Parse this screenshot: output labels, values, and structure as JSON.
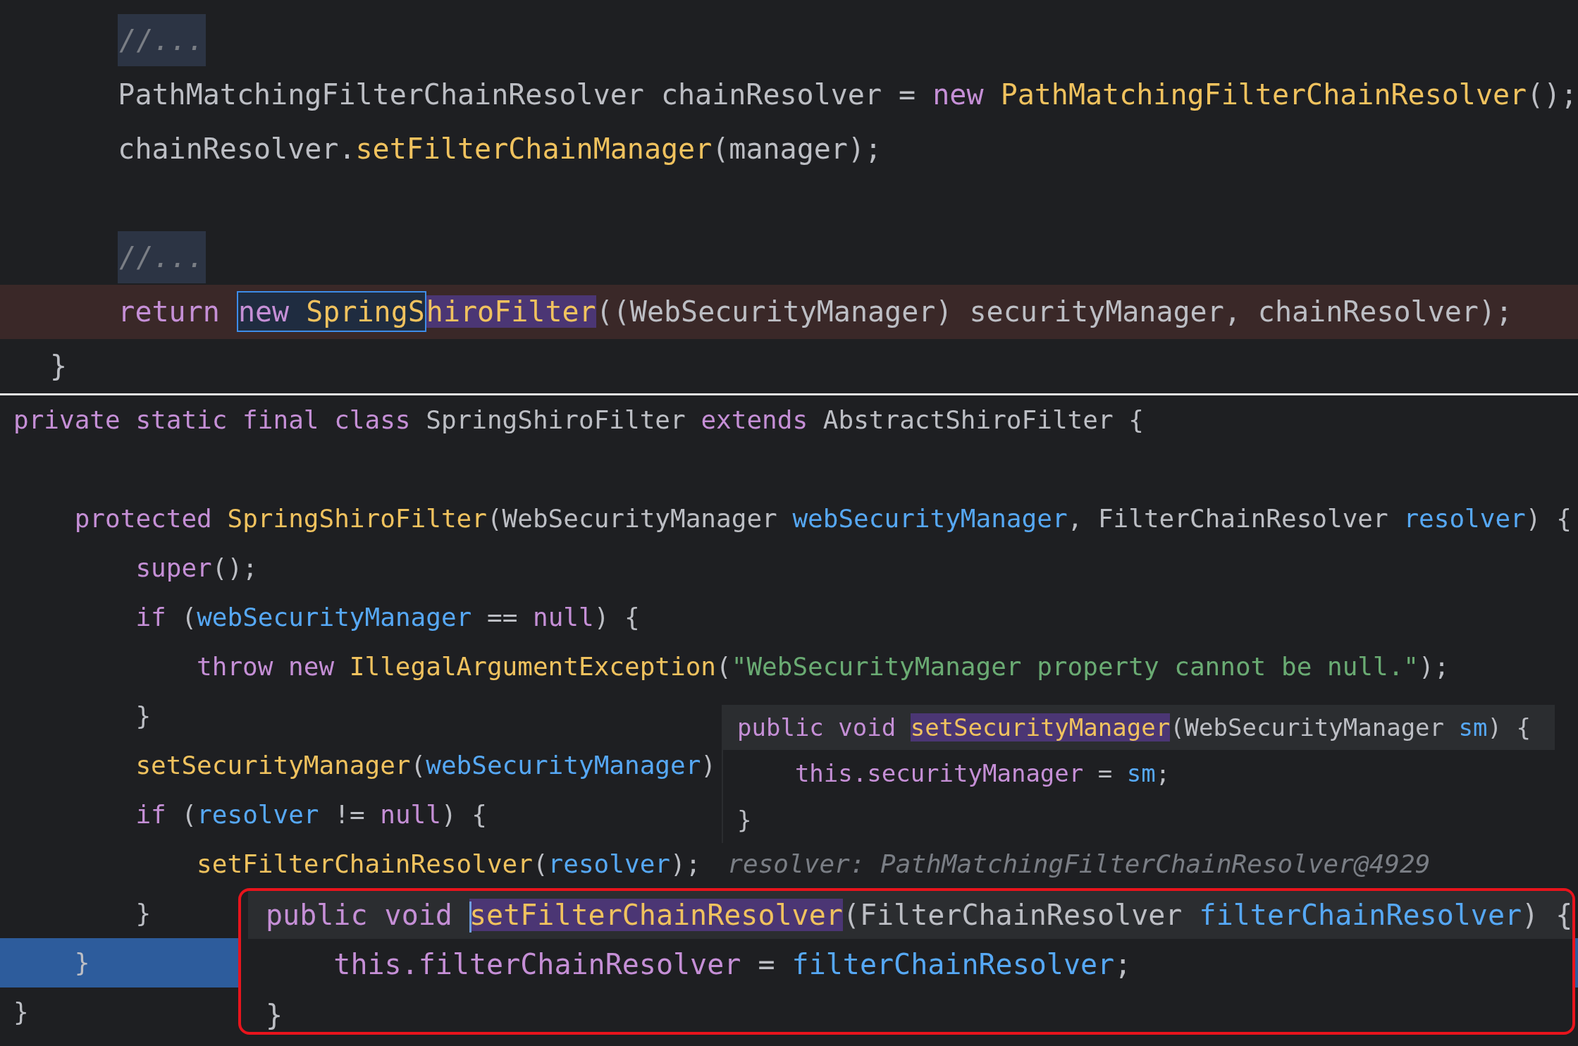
{
  "top_editor": {
    "lines": [
      {
        "kind": "block",
        "children": [
          {
            "kind": "code",
            "tokens": [
              {
                "text": "//...",
                "kind": "comment"
              }
            ]
          },
          {
            "kind": "code",
            "tokens": [
              {
                "text": "PathMatchingFilterChainResolver chainResolver = ",
                "kind": "plain"
              },
              {
                "text": "new",
                "kind": "kw"
              },
              {
                "text": " PathMatchingFilterChainResolver",
                "kind": "fn"
              },
              {
                "text": "();",
                "kind": "plain"
              }
            ]
          },
          {
            "kind": "code",
            "tokens": [
              {
                "text": "chainResolver.",
                "kind": "plain"
              },
              {
                "text": "setFilterChainManager",
                "kind": "fn"
              },
              {
                "text": "(manager);",
                "kind": "plain"
              }
            ]
          },
          {
            "kind": "blank"
          },
          {
            "kind": "code",
            "tokens": [
              {
                "text": "//...",
                "kind": "comment"
              }
            ]
          },
          {
            "kind": "code",
            "breakpoint": true,
            "tokens": [
              {
                "text": "return ",
                "kind": "kw"
              },
              {
                "kind": "selection",
                "parts": [
                  {
                    "text": "new",
                    "kind": "kw"
                  },
                  {
                    "text": " SpringS",
                    "kind": "fn"
                  }
                ]
              },
              {
                "text": "hiroFilter",
                "kind": "fn",
                "highlighted": true
              },
              {
                "text": "((WebSecurityManager) securityManager, chainResolver);",
                "kind": "plain"
              }
            ]
          }
        ]
      },
      {
        "kind": "code",
        "tokens": [
          {
            "text": "}",
            "kind": "plain"
          }
        ]
      }
    ]
  },
  "bottom_editor": {
    "lines": [
      {
        "kind": "code",
        "tokens": [
          {
            "text": "private static final class",
            "kind": "kw"
          },
          {
            "text": " SpringShiroFilter",
            "kind": "plain"
          },
          {
            "text": " extends",
            "kind": "kw"
          },
          {
            "text": " AbstractShiroFilter {",
            "kind": "plain"
          }
        ],
        "children": [
          {
            "kind": "blank"
          },
          {
            "kind": "code",
            "tokens": [
              {
                "text": "protected",
                "kind": "kw"
              },
              {
                "text": " SpringShiroFilter",
                "kind": "fn"
              },
              {
                "text": "(WebSecurityManager",
                "kind": "plain"
              },
              {
                "text": " webSecurityManager",
                "kind": "param"
              },
              {
                "text": ", FilterChainResolver",
                "kind": "plain"
              },
              {
                "text": " resolver",
                "kind": "param"
              },
              {
                "text": ") {",
                "kind": "plain"
              }
            ],
            "children": [
              {
                "kind": "code",
                "tokens": [
                  {
                    "text": "super",
                    "kind": "kw"
                  },
                  {
                    "text": "();",
                    "kind": "plain"
                  }
                ]
              },
              {
                "kind": "code",
                "tokens": [
                  {
                    "text": "if",
                    "kind": "kw"
                  },
                  {
                    "text": " (",
                    "kind": "plain"
                  },
                  {
                    "text": "webSecurityManager",
                    "kind": "param"
                  },
                  {
                    "text": " ==",
                    "kind": "plain"
                  },
                  {
                    "text": " null",
                    "kind": "kw"
                  },
                  {
                    "text": ") {",
                    "kind": "plain"
                  }
                ],
                "children": [
                  {
                    "kind": "code",
                    "tokens": [
                      {
                        "text": "throw new",
                        "kind": "kw"
                      },
                      {
                        "text": " IllegalArgumentException",
                        "kind": "fn"
                      },
                      {
                        "text": "(",
                        "kind": "plain"
                      },
                      {
                        "text": "\"WebSecurityManager property cannot be null.\"",
                        "kind": "str"
                      },
                      {
                        "text": ");",
                        "kind": "plain"
                      }
                    ]
                  }
                ]
              },
              {
                "kind": "code",
                "tokens": [
                  {
                    "text": "}",
                    "kind": "plain"
                  }
                ]
              },
              {
                "kind": "code",
                "tokens": [
                  {
                    "text": "setSecurityManager",
                    "kind": "fn"
                  },
                  {
                    "text": "(",
                    "kind": "plain"
                  },
                  {
                    "text": "webSecurityManager",
                    "kind": "param"
                  },
                  {
                    "text": ")",
                    "kind": "plain"
                  }
                ]
              },
              {
                "kind": "code",
                "tokens": [
                  {
                    "text": "if",
                    "kind": "kw"
                  },
                  {
                    "text": " (",
                    "kind": "plain"
                  },
                  {
                    "text": "resolver",
                    "kind": "param"
                  },
                  {
                    "text": " !=",
                    "kind": "plain"
                  },
                  {
                    "text": " null",
                    "kind": "kw"
                  },
                  {
                    "text": ") {",
                    "kind": "plain"
                  }
                ],
                "children": [
                  {
                    "kind": "code",
                    "tokens": [
                      {
                        "text": "setFilterChainResolver",
                        "kind": "fn"
                      },
                      {
                        "text": "(",
                        "kind": "plain"
                      },
                      {
                        "text": "resolver",
                        "kind": "param"
                      },
                      {
                        "text": ");",
                        "kind": "plain"
                      },
                      {
                        "text": "resolver: PathMatchingFilterChainResolver@4929",
                        "kind": "hint"
                      }
                    ]
                  }
                ]
              },
              {
                "kind": "code",
                "tokens": [
                  {
                    "text": "}",
                    "kind": "plain"
                  }
                ]
              }
            ]
          },
          {
            "kind": "code",
            "execution_point": true,
            "tokens": [
              {
                "text": "}",
                "kind": "plain"
              }
            ]
          }
        ]
      },
      {
        "kind": "code",
        "tokens": [
          {
            "text": "}",
            "kind": "plain"
          }
        ]
      }
    ]
  },
  "popups": [
    {
      "framed": false,
      "lines": [
        {
          "kind": "code",
          "tokens": [
            {
              "text": "public void",
              "kind": "kw"
            },
            {
              "text": " setSecurityManager",
              "kind": "fn",
              "highlighted": true
            },
            {
              "text": "(WebSecurityManager",
              "kind": "plain"
            },
            {
              "text": " sm",
              "kind": "param"
            },
            {
              "text": ") {",
              "kind": "plain"
            }
          ],
          "children": [
            {
              "kind": "code",
              "tokens": [
                {
                  "text": "this.securityManager",
                  "kind": "kw"
                },
                {
                  "text": " =",
                  "kind": "plain"
                },
                {
                  "text": " sm",
                  "kind": "param"
                },
                {
                  "text": ";",
                  "kind": "plain"
                }
              ]
            }
          ]
        },
        {
          "kind": "code",
          "tokens": [
            {
              "text": "}",
              "kind": "plain"
            }
          ]
        }
      ]
    },
    {
      "framed": true,
      "lines": [
        {
          "kind": "code",
          "tokens": [
            {
              "text": "public void",
              "kind": "kw"
            },
            {
              "text": " setFilterChainResolver",
              "kind": "fn",
              "highlighted": true,
              "caret": true
            },
            {
              "text": "(FilterChainResolver",
              "kind": "plain"
            },
            {
              "text": " filterChainResolver",
              "kind": "param"
            },
            {
              "text": ") {",
              "kind": "plain"
            }
          ],
          "children": [
            {
              "kind": "code",
              "tokens": [
                {
                  "text": "this.filterChainResolver",
                  "kind": "kw"
                },
                {
                  "text": " =",
                  "kind": "plain"
                },
                {
                  "text": " filterChainResolver",
                  "kind": "param"
                },
                {
                  "text": ";",
                  "kind": "plain"
                }
              ]
            }
          ]
        },
        {
          "kind": "code",
          "tokens": [
            {
              "text": "}",
              "kind": "plain"
            }
          ]
        }
      ]
    }
  ]
}
